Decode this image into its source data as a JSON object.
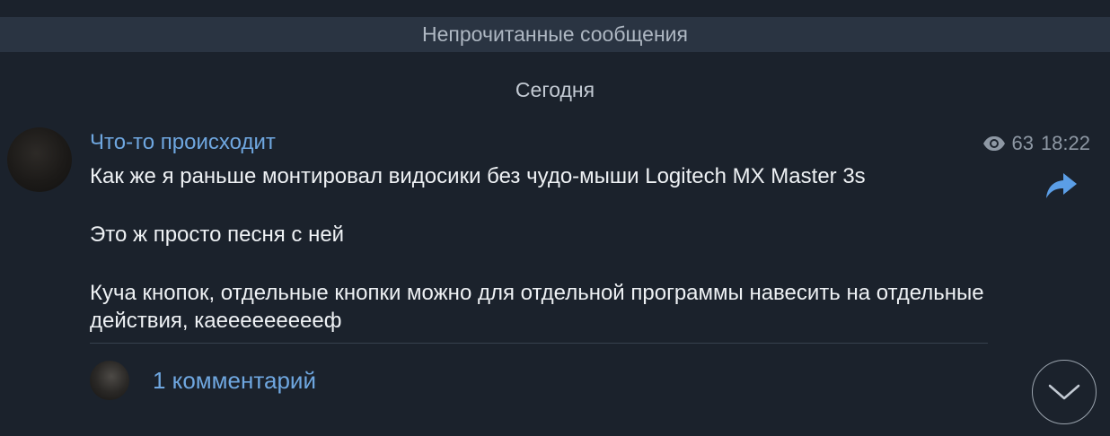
{
  "unread_bar": {
    "label": "Непрочитанные сообщения"
  },
  "date_separator": {
    "label": "Сегодня"
  },
  "post": {
    "sender": "Что-то происходит",
    "views": "63",
    "time": "18:22",
    "paragraphs": [
      "Как же я раньше монтировал видосики без чудо-мыши Logitech MX Master 3s",
      "Это ж просто песня с ней",
      "Куча кнопок, отдельные кнопки можно для отдельной программы навесить на отдельные действия, каеееееееееф"
    ],
    "comments_label": "1 комментарий"
  },
  "icons": {
    "views": "eye-icon",
    "share": "share-arrow-icon",
    "scroll": "chevron-down-icon"
  },
  "colors": {
    "background": "#1b222c",
    "unread_bar": "#2a3442",
    "accent": "#6fa7e0",
    "share_icon": "#5b9ee6"
  }
}
